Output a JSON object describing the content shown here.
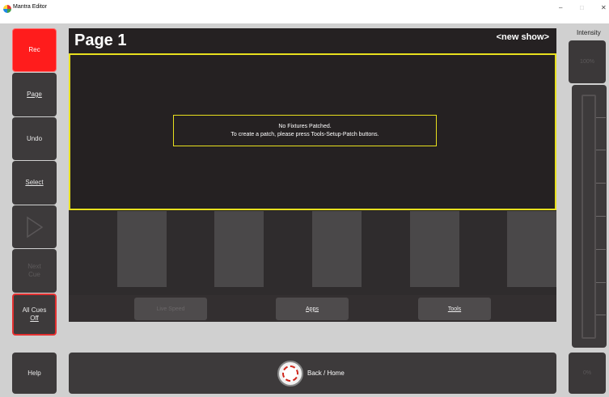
{
  "window": {
    "title": "Mantra Editor",
    "minimize": "–",
    "maximize": "□",
    "close": "✕"
  },
  "left_buttons": {
    "rec": "Rec",
    "page": "Page",
    "undo": "Undo",
    "select": "Select",
    "next_cue_line1": "Next",
    "next_cue_line2": "Cue",
    "all_cues_line1": "All Cues",
    "all_cues_line2": "Off",
    "help": "Help"
  },
  "main": {
    "page_title": "Page 1",
    "show_name": "<new show>",
    "message_line1": "No Fixtures Patched.",
    "message_line2": "To create a patch, please press Tools-Setup-Patch buttons.",
    "buttons": {
      "live_speed": "Live Speed",
      "apps": "Apps",
      "tools": "Tools"
    }
  },
  "home": {
    "label": "Back / Home"
  },
  "right_panel": {
    "intensity_label": "Intensity",
    "top_value": "100%",
    "bottom_value": "0%"
  },
  "colors": {
    "accent_red": "#ff1c1c",
    "highlight_yellow": "#e8e01e",
    "panel_dark": "#252122"
  }
}
